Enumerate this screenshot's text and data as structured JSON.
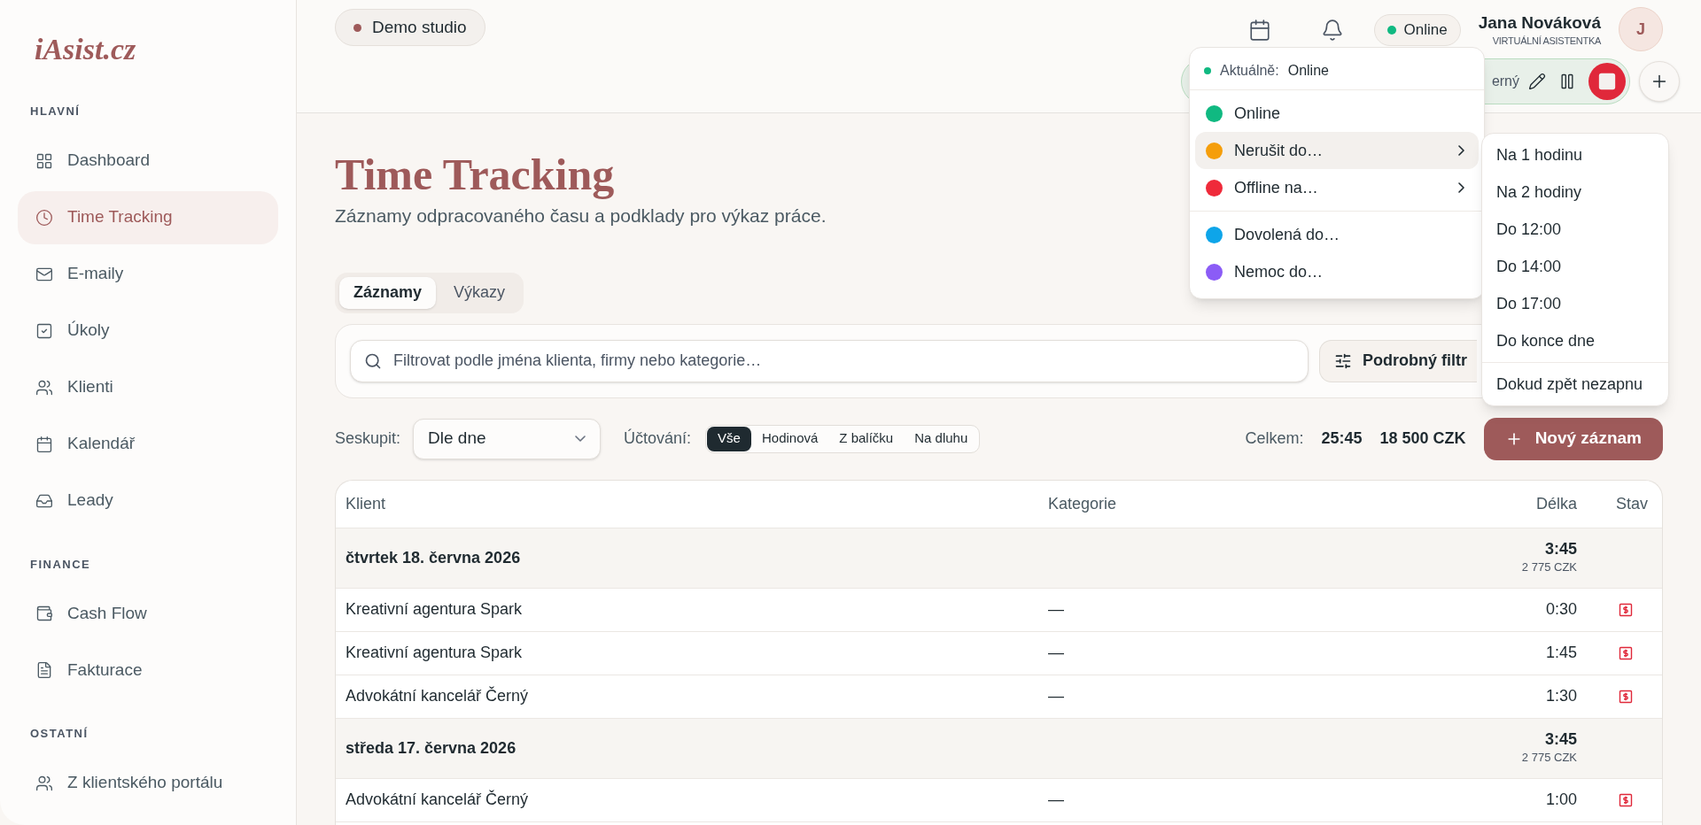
{
  "sidebar": {
    "logo": "iAsist.cz",
    "sections": [
      {
        "title": "HLAVNÍ",
        "items": [
          {
            "label": "Dashboard",
            "selected": false
          },
          {
            "label": "Time Tracking",
            "selected": true
          },
          {
            "label": "E-maily",
            "selected": false
          },
          {
            "label": "Úkoly",
            "selected": false
          },
          {
            "label": "Klienti",
            "selected": false
          },
          {
            "label": "Kalendář",
            "selected": false
          },
          {
            "label": "Leady",
            "selected": false
          }
        ]
      },
      {
        "title": "FINANCE",
        "items": [
          {
            "label": "Cash Flow",
            "selected": false
          },
          {
            "label": "Fakturace",
            "selected": false
          }
        ]
      },
      {
        "title": "OSTATNÍ",
        "items": [
          {
            "label": "Z klientského portálu",
            "selected": false
          }
        ]
      }
    ]
  },
  "header": {
    "workspace": {
      "label": "Demo studio",
      "color": "#9e5a5a"
    },
    "status": {
      "label": "Online",
      "color": "#10b981"
    },
    "user": {
      "name": "Jana Nováková",
      "role": "VIRTUÁLNÍ ASISTENTKA",
      "initial": "J"
    },
    "timer": {
      "client": "erný"
    }
  },
  "status_menu": {
    "current": {
      "label": "Aktuálně:",
      "value": "Online",
      "color": "#10b981"
    },
    "groups": [
      [
        {
          "label": "Online",
          "color": "#10b981",
          "submenu": false,
          "selected": false
        },
        {
          "label": "Nerušit do…",
          "color": "#f59e0b",
          "submenu": true,
          "selected": true
        },
        {
          "label": "Offline na…",
          "color": "#ef2a3a",
          "submenu": true,
          "selected": false
        }
      ],
      [
        {
          "label": "Dovolená do…",
          "color": "#0ea5e9",
          "submenu": false,
          "selected": false
        },
        {
          "label": "Nemoc do…",
          "color": "#8b5cf6",
          "submenu": false,
          "selected": false
        }
      ]
    ],
    "submenu": [
      [
        "Na 1 hodinu",
        "Na 2 hodiny",
        "Do 12:00",
        "Do 14:00",
        "Do 17:00",
        "Do konce dne"
      ],
      [
        "Dokud zpět nezapnu"
      ]
    ]
  },
  "page": {
    "title": "Time Tracking",
    "subtitle": "Záznamy odpracovaného času a podklady pro výkaz práce.",
    "tabs": [
      {
        "label": "Záznamy",
        "selected": true
      },
      {
        "label": "Výkazy",
        "selected": false
      }
    ],
    "search": {
      "placeholder": "Filtrovat podle jména klienta, firmy nebo kategorie…"
    },
    "filter_button": "Podrobný filtr",
    "group_by": {
      "label": "Seskupit:",
      "value": "Dle dne"
    },
    "billing": {
      "label": "Účtování:",
      "options": [
        {
          "label": "Vše",
          "selected": true
        },
        {
          "label": "Hodinová",
          "selected": false
        },
        {
          "label": "Z balíčku",
          "selected": false
        },
        {
          "label": "Na dluhu",
          "selected": false
        }
      ]
    },
    "total": {
      "label": "Celkem:",
      "hours": "25:45",
      "amount": "18 500 CZK"
    },
    "new_button": "Nový záznam"
  },
  "table": {
    "columns": [
      "Klient",
      "Kategorie",
      "Délka",
      "Stav"
    ],
    "groups": [
      {
        "date": "čtvrtek 18. června 2026",
        "hours": "3:45",
        "amount": "2 775 CZK",
        "rows": [
          {
            "client": "Kreativní agentura Spark",
            "category": "—",
            "duration": "0:30",
            "unbilled": true
          },
          {
            "client": "Kreativní agentura Spark",
            "category": "—",
            "duration": "1:45",
            "unbilled": true
          },
          {
            "client": "Advokátní kancelář Černý",
            "category": "—",
            "duration": "1:30",
            "unbilled": true
          }
        ]
      },
      {
        "date": "středa 17. června 2026",
        "hours": "3:45",
        "amount": "2 775 CZK",
        "rows": [
          {
            "client": "Advokátní kancelář Černý",
            "category": "—",
            "duration": "1:00",
            "unbilled": true
          }
        ]
      }
    ]
  }
}
